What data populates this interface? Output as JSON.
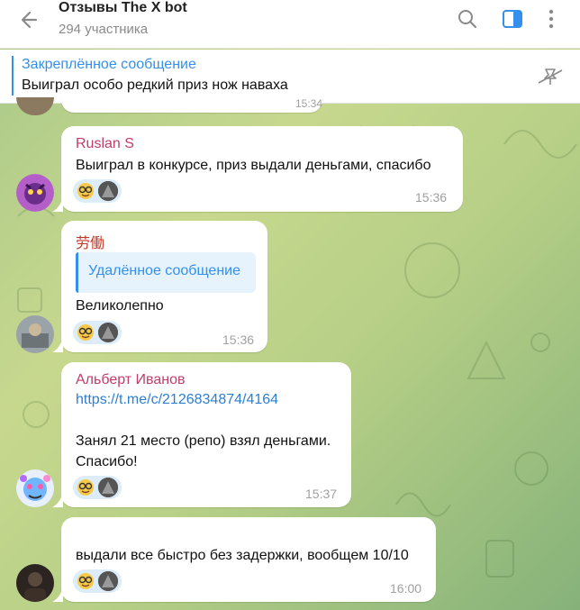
{
  "header": {
    "title": "Отзывы The X bot",
    "subtitle": "294 участника",
    "icons": [
      "back-arrow-icon",
      "search-icon",
      "sidebar-panel-icon",
      "more-vertical-icon"
    ]
  },
  "pinned": {
    "title": "Закреплённое сообщение",
    "text": "Выиграл особо редкий приз нож наваха",
    "icon": "unpin-icon"
  },
  "prev_message": {
    "time": "15:34"
  },
  "messages": [
    {
      "author": "Ruslan S",
      "author_color": "#c03d6a",
      "text": "Выиграл в конкурсе, приз выдали деньгами, спасибо",
      "time": "15:36",
      "reaction_emoji": "🤓"
    },
    {
      "author": "劳働",
      "author_color": "#c0392b",
      "reply": "Удалённое сообщение",
      "text": "Великолепно",
      "time": "15:36",
      "reaction_emoji": "🤓"
    },
    {
      "author": "Альберт Иванов",
      "author_color": "#c03d6a",
      "link": "https://t.me/c/2126834874/4164",
      "text_line1": "Занял 21 место (репо) взял деньгами.",
      "text_line2": "Спасибо!",
      "time": "15:37",
      "reaction_emoji": "🤓"
    },
    {
      "text": "выдали все быстро без задержки, вообщем 10/10",
      "time": "16:00",
      "reaction_emoji": "🤓"
    }
  ],
  "colors": {
    "accent": "#3390ec",
    "header_bg": "#ffffff",
    "chat_bg": "#b6cf86",
    "reaction_bg": "#dcecf9"
  }
}
